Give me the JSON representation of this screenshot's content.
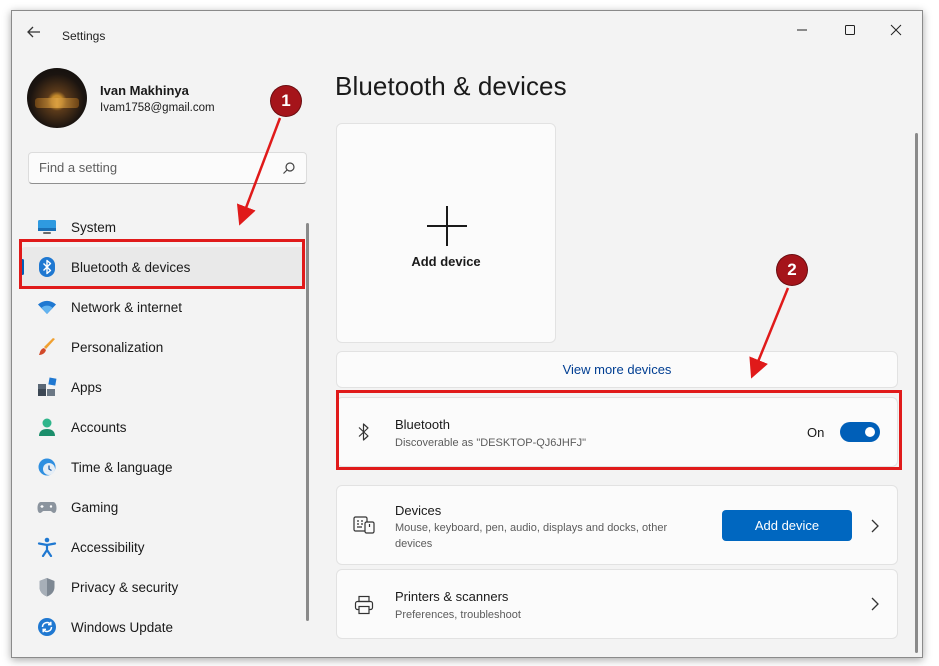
{
  "window": {
    "app_title": "Settings",
    "controls": {
      "minimize": "—",
      "maximize": "☐",
      "close": "✕"
    }
  },
  "profile": {
    "name": "Ivan Makhinya",
    "email": "Ivam1758@gmail.com"
  },
  "search": {
    "placeholder": "Find a setting",
    "value": ""
  },
  "nav": {
    "items": [
      {
        "label": "System",
        "icon": "monitor-icon"
      },
      {
        "label": "Bluetooth & devices",
        "icon": "bluetooth-icon",
        "active": true
      },
      {
        "label": "Network & internet",
        "icon": "wifi-icon"
      },
      {
        "label": "Personalization",
        "icon": "brush-icon"
      },
      {
        "label": "Apps",
        "icon": "apps-icon"
      },
      {
        "label": "Accounts",
        "icon": "person-icon"
      },
      {
        "label": "Time & language",
        "icon": "clock-globe-icon"
      },
      {
        "label": "Gaming",
        "icon": "gamepad-icon"
      },
      {
        "label": "Accessibility",
        "icon": "accessibility-icon"
      },
      {
        "label": "Privacy & security",
        "icon": "shield-icon"
      },
      {
        "label": "Windows Update",
        "icon": "update-icon"
      }
    ]
  },
  "main": {
    "title": "Bluetooth & devices",
    "add_tile_label": "Add device",
    "view_more": "View more devices",
    "bluetooth": {
      "title": "Bluetooth",
      "subtitle": "Discoverable as \"DESKTOP-QJ6JHFJ\"",
      "state": "On",
      "enabled": true
    },
    "devices": {
      "title": "Devices",
      "subtitle": "Mouse, keyboard, pen, audio, displays and docks, other devices",
      "button": "Add device"
    },
    "printers": {
      "title": "Printers & scanners",
      "subtitle": "Preferences, troubleshoot"
    }
  },
  "annotations": {
    "badge1": "1",
    "badge2": "2",
    "color": "#e01a1a",
    "badge_color": "#a5141a"
  },
  "colors": {
    "accent": "#005fb8",
    "button": "#0067c0",
    "window_bg": "#f3f3f3"
  }
}
